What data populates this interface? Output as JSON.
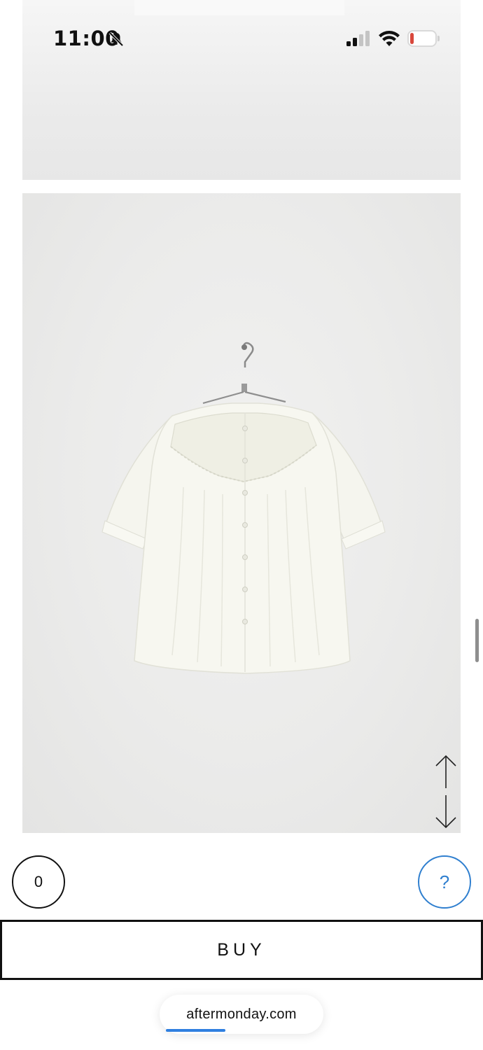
{
  "status_bar": {
    "time": "11:00",
    "battery_level": "12",
    "icons": [
      "bell-slash-icon",
      "cellular-signal-icon",
      "wifi-icon",
      "battery-icon"
    ]
  },
  "actions": {
    "cart_count": "0",
    "help_label": "?",
    "buy_label": "BUY"
  },
  "browser": {
    "url": "aftermonday.com"
  },
  "icons": {
    "scroll_up": "arrow-up-icon",
    "scroll_down": "arrow-down-icon"
  },
  "colors": {
    "accent_blue": "#2f7fcf",
    "battery_low": "#d8473b"
  }
}
